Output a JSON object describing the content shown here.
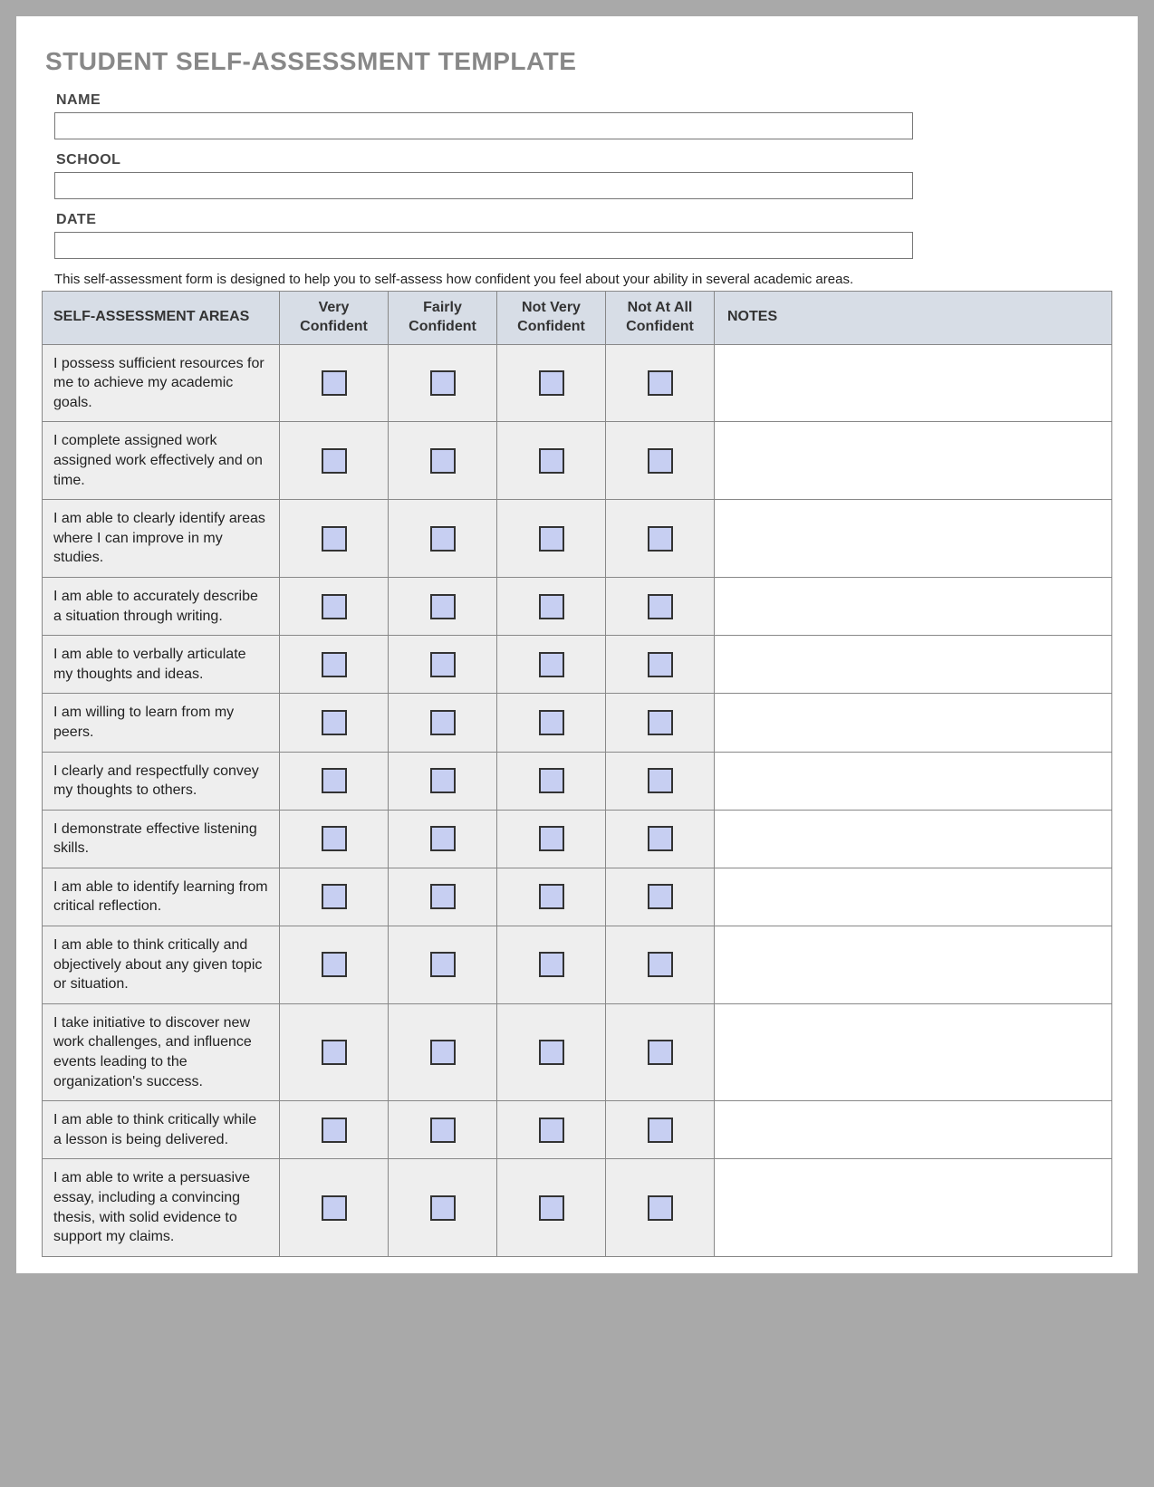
{
  "title": "STUDENT SELF-ASSESSMENT TEMPLATE",
  "fields": {
    "name_label": "NAME",
    "name_value": "",
    "school_label": "SCHOOL",
    "school_value": "",
    "date_label": "DATE",
    "date_value": ""
  },
  "description": "This self-assessment form is designed to help you to self-assess how confident you feel about your ability in several academic areas.",
  "columns": {
    "areas": "SELF-ASSESSMENT AREAS",
    "c1": "Very Confident",
    "c2": "Fairly Confident",
    "c3": "Not Very Confident",
    "c4": "Not At All Confident",
    "notes": "NOTES"
  },
  "rows": [
    {
      "area": "I possess sufficient resources for me to achieve my academic goals.",
      "notes": ""
    },
    {
      "area": "I complete assigned work assigned work effectively and on time.",
      "notes": ""
    },
    {
      "area": "I am able to clearly identify areas where I can improve in my studies.",
      "notes": ""
    },
    {
      "area": "I am able to accurately describe a situation through writing.",
      "notes": ""
    },
    {
      "area": "I am able to verbally articulate my thoughts and ideas.",
      "notes": ""
    },
    {
      "area": "I am willing to learn from my peers.",
      "notes": ""
    },
    {
      "area": "I clearly and respectfully convey my thoughts to others.",
      "notes": ""
    },
    {
      "area": "I demonstrate effective listening skills.",
      "notes": ""
    },
    {
      "area": "I am able to identify learning from critical reflection.",
      "notes": ""
    },
    {
      "area": "I am able to think critically and objectively about any given topic or situation.",
      "notes": ""
    },
    {
      "area": "I take initiative to discover new work challenges, and influence events leading to the organization's success.",
      "notes": ""
    },
    {
      "area": "I am able to think critically while a lesson is being delivered.",
      "notes": ""
    },
    {
      "area": "I am able to write a persuasive essay, including a convincing thesis, with solid evidence to support my claims.",
      "notes": ""
    }
  ]
}
